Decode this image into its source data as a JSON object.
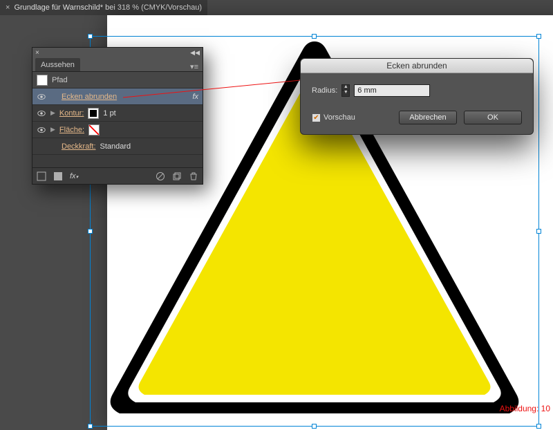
{
  "document_tab": "Grundlage für Warnschild* bei 318 % (CMYK/Vorschau)",
  "appearance_panel": {
    "title": "Aussehen",
    "path_label": "Pfad",
    "effect_row": "Ecken abrunden",
    "stroke": {
      "label": "Kontur:",
      "value": "1 pt"
    },
    "fill": {
      "label": "Fläche:"
    },
    "opacity": {
      "label": "Deckkraft:",
      "value": "Standard"
    }
  },
  "dialog": {
    "title": "Ecken abrunden",
    "radius_label": "Radius:",
    "radius_value": "6 mm",
    "preview": "Vorschau",
    "cancel": "Abbrechen",
    "ok": "OK"
  },
  "caption": "Abbildung: 10",
  "colors": {
    "triangle_fill": "#f4e500",
    "triangle_border": "#000000",
    "selection": "#0084d6"
  }
}
